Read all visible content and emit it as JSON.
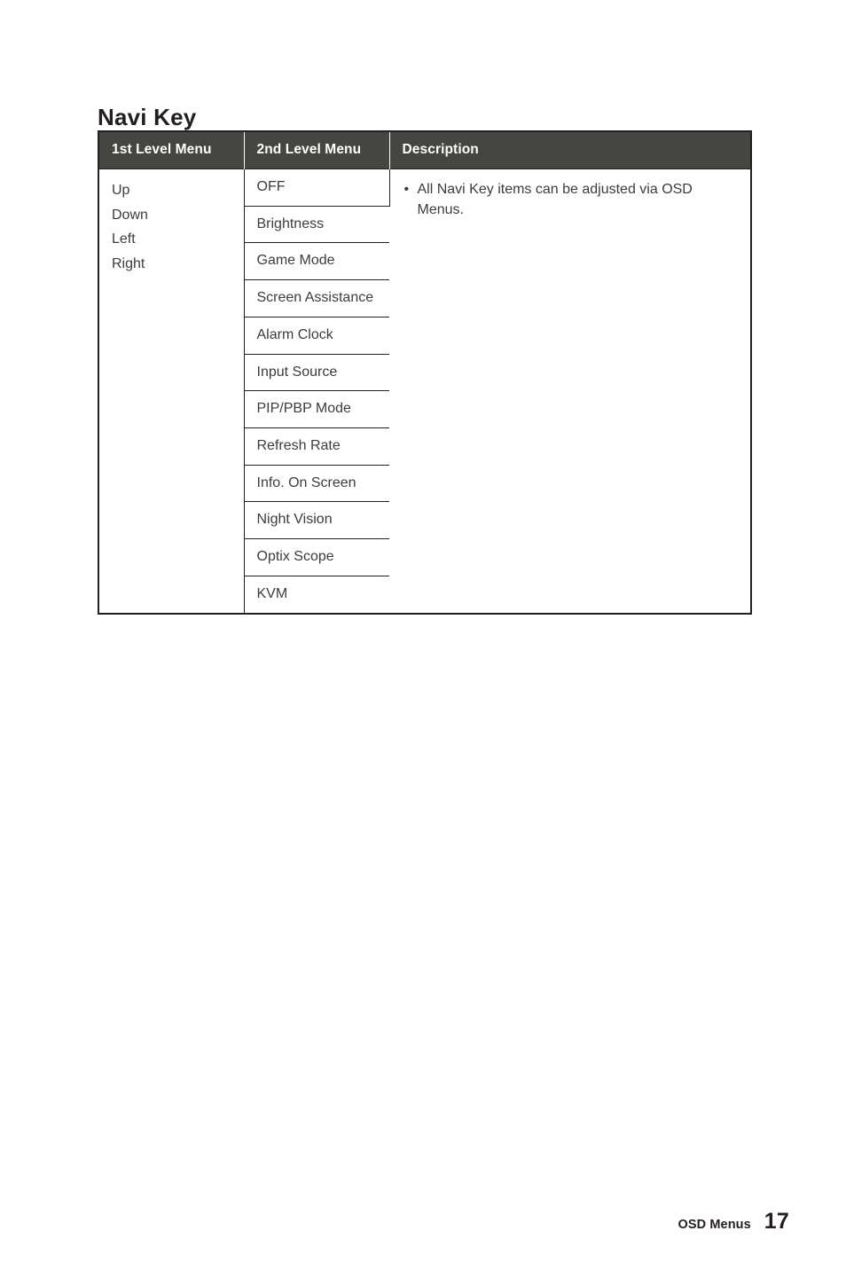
{
  "document": {
    "section_title": "Navi Key"
  },
  "table": {
    "headers": {
      "col1": "1st Level Menu",
      "col2": "2nd Level Menu",
      "col3": "Description"
    },
    "first_level_menu": [
      "Up",
      "Down",
      "Left",
      "Right"
    ],
    "second_level_menu": [
      "OFF",
      "Brightness",
      "Game Mode",
      "Screen Assistance",
      "Alarm Clock",
      "Input Source",
      "PIP/PBP Mode",
      "Refresh Rate",
      "Info. On Screen",
      "Night Vision",
      "Optix Scope",
      "KVM"
    ],
    "description_bullets": [
      "All Navi Key items can be adjusted via OSD Menus."
    ],
    "bullet_glyph": "•"
  },
  "footer": {
    "label": "OSD Menus",
    "page_number": "17"
  },
  "colors": {
    "header_background": "#454542",
    "header_text": "#ffffff",
    "border": "#231f20",
    "body_text": "#3c3c3c",
    "title_text": "#231f20",
    "page_background": "#ffffff"
  }
}
